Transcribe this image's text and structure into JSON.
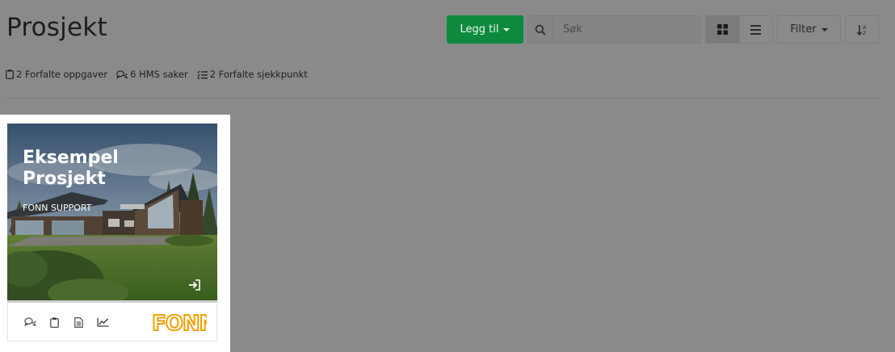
{
  "header": {
    "title": "Prosjekt",
    "add_button_label": "Legg til",
    "search_placeholder": "Søk",
    "filter_label": "Filter"
  },
  "stats": [
    {
      "label": "2 Forfalte oppgaver",
      "icon": "clipboard-icon"
    },
    {
      "label": "6 HMS saker",
      "icon": "chat-bubbles-icon"
    },
    {
      "label": "2 Forfalte sjekkpunkt",
      "icon": "checklist-icon"
    }
  ],
  "project_card": {
    "title": "Eksempel Prosjekt",
    "subtitle": "FONN SUPPORT",
    "logo_text": "FONN",
    "footer_icons": [
      "chat-bubbles-icon",
      "clipboard-icon",
      "document-icon",
      "chart-line-icon"
    ]
  },
  "colors": {
    "accent_green": "#0e8a3e",
    "logo_orange": "#f2a000",
    "overlay_gray": "#8a8a8a"
  }
}
